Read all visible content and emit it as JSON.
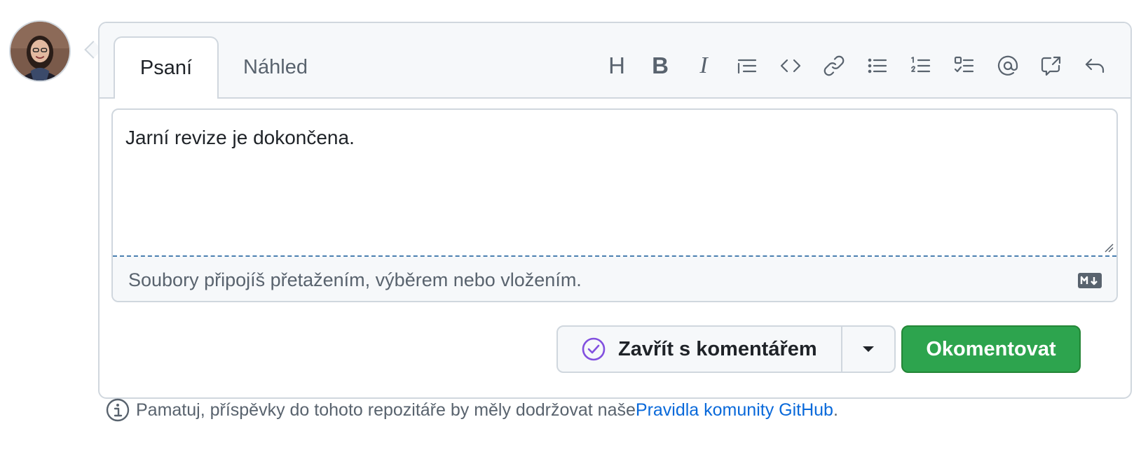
{
  "tabs": {
    "write": "Psaní",
    "preview": "Náhled"
  },
  "toolbar": {
    "items": [
      {
        "icon": "heading-icon",
        "glyph": "H"
      },
      {
        "icon": "bold-icon",
        "glyph": "B"
      },
      {
        "icon": "italic-icon",
        "glyph": "I"
      },
      {
        "icon": "quote-icon"
      },
      {
        "icon": "code-icon"
      },
      {
        "icon": "link-icon"
      },
      {
        "icon": "unordered-list-icon"
      },
      {
        "icon": "ordered-list-icon"
      },
      {
        "icon": "task-list-icon"
      },
      {
        "icon": "mention-icon"
      },
      {
        "icon": "cross-reference-icon"
      },
      {
        "icon": "reply-icon"
      }
    ]
  },
  "editor": {
    "value": "Jarní revize je dokončena.",
    "attach_hint": "Soubory připojíš přetažením, výběrem nebo vložením."
  },
  "actions": {
    "close_label": "Zavřít s komentářem",
    "comment_label": "Okomentovat"
  },
  "note": {
    "text": "Pamatuj, příspěvky do tohoto repozitáře by měly dodržovat naše ",
    "link": "Pravidla komunity GitHub",
    "suffix": "."
  },
  "colors": {
    "accent_green": "#2da44e",
    "link_blue": "#0969da",
    "close_purple": "#8250df",
    "border": "#d0d7de"
  }
}
